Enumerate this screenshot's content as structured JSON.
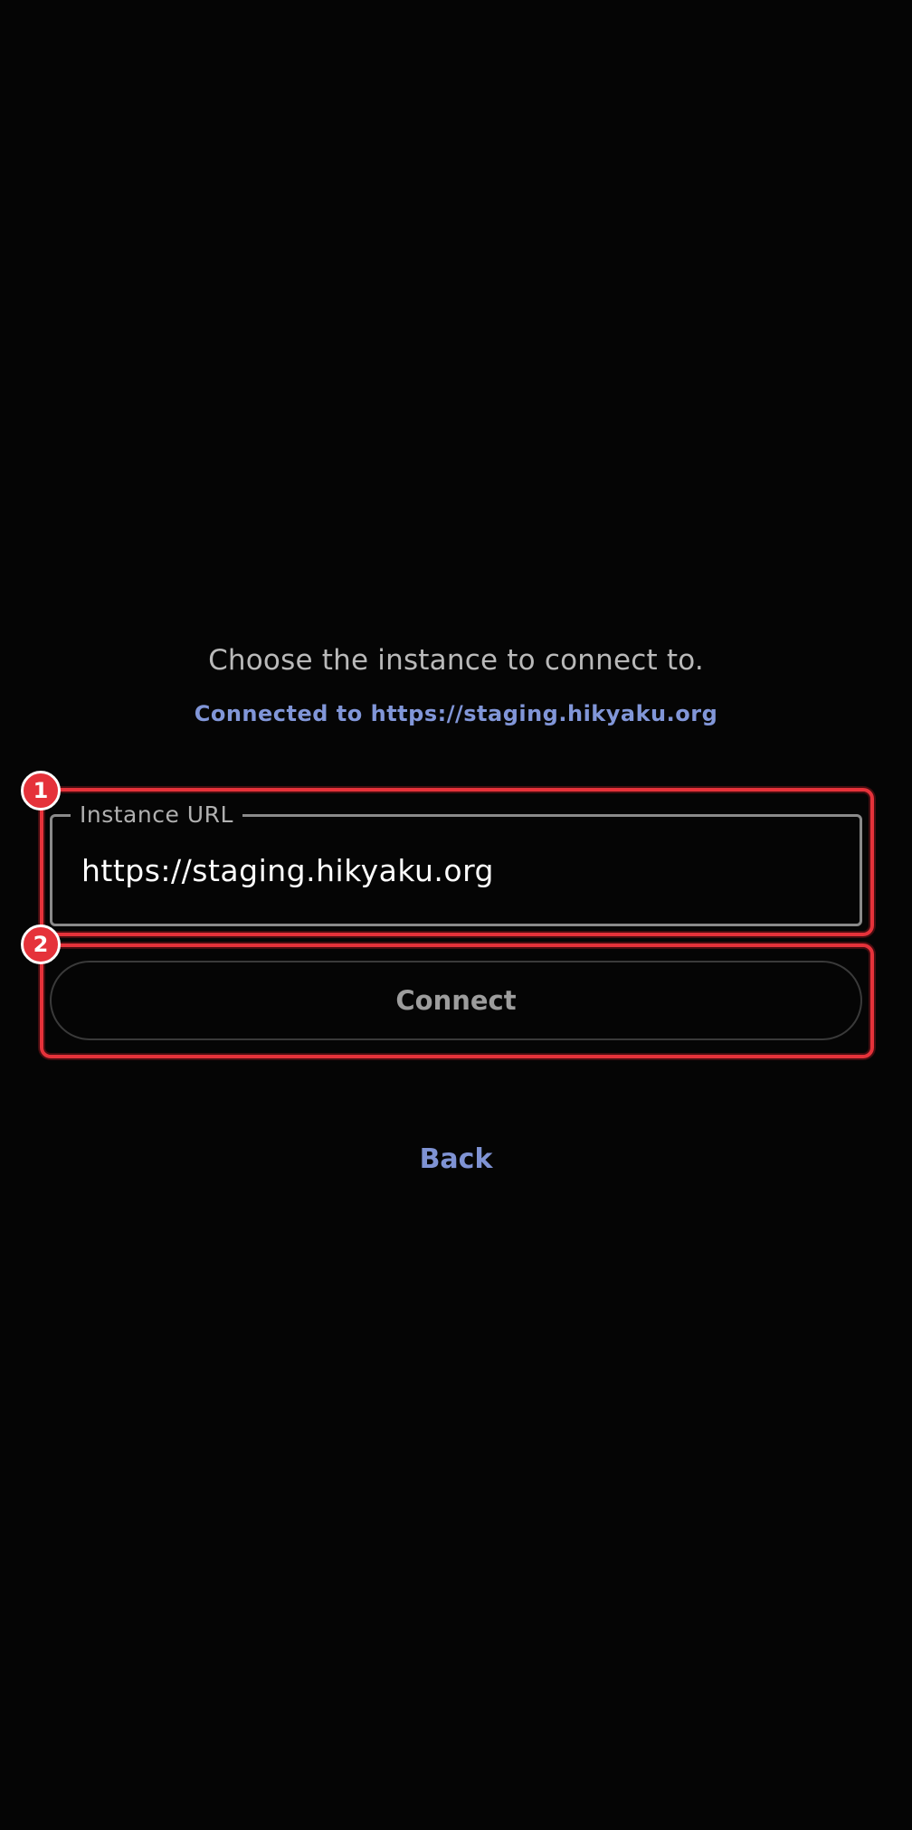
{
  "prompt_text": "Choose the instance to connect to.",
  "status_text": "Connected to https://staging.hikyaku.org",
  "instance_field": {
    "label": "Instance URL",
    "value": "https://staging.hikyaku.org"
  },
  "connect_label": "Connect",
  "back_label": "Back",
  "annotations": {
    "badge_1": "1",
    "badge_2": "2"
  },
  "colors": {
    "background": "#050505",
    "accent": "#8196d8",
    "annotation": "#e5323a"
  }
}
